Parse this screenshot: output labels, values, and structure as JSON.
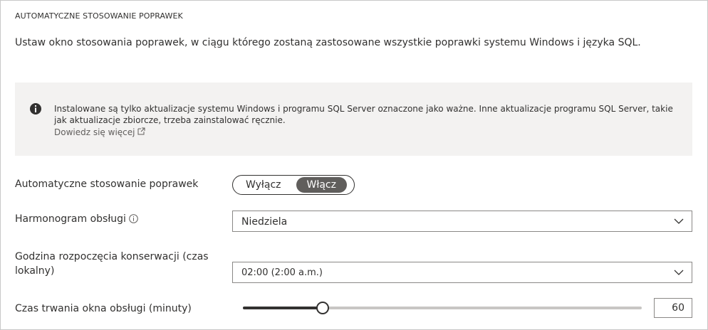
{
  "section_title": "AUTOMATYCZNE STOSOWANIE POPRAWEK",
  "description": "Ustaw okno stosowania poprawek, w ciągu którego zostaną zastosowane wszystkie poprawki systemu Windows i języka SQL.",
  "info": {
    "icon": "info-filled-icon",
    "text": "Instalowane są tylko aktualizacje systemu Windows i programu SQL Server oznaczone jako ważne. Inne aktualizacje programu SQL Server, takie jak aktualizacje zbiorcze, trzeba zainstalować ręcznie.",
    "link_label": "Dowiedz się więcej",
    "link_icon": "external-link-icon"
  },
  "auto_patching": {
    "label": "Automatyczne stosowanie poprawek",
    "off_label": "Wyłącz",
    "on_label": "Włącz",
    "selected": "Włącz"
  },
  "schedule": {
    "label": "Harmonogram obsługi",
    "info_icon": "info-circle-icon",
    "value": "Niedziela"
  },
  "start_hour": {
    "label": "Godzina rozpoczęcia konserwacji (czas lokalny)",
    "value": "02:00 (2:00 a.m.)"
  },
  "duration": {
    "label": "Czas trwania okna obsługi (minuty)",
    "value": "60",
    "slider_fraction": 0.2
  },
  "colors": {
    "info_bg": "#f3f2f1",
    "toggle_on_bg": "#605e5c",
    "text": "#323130"
  }
}
